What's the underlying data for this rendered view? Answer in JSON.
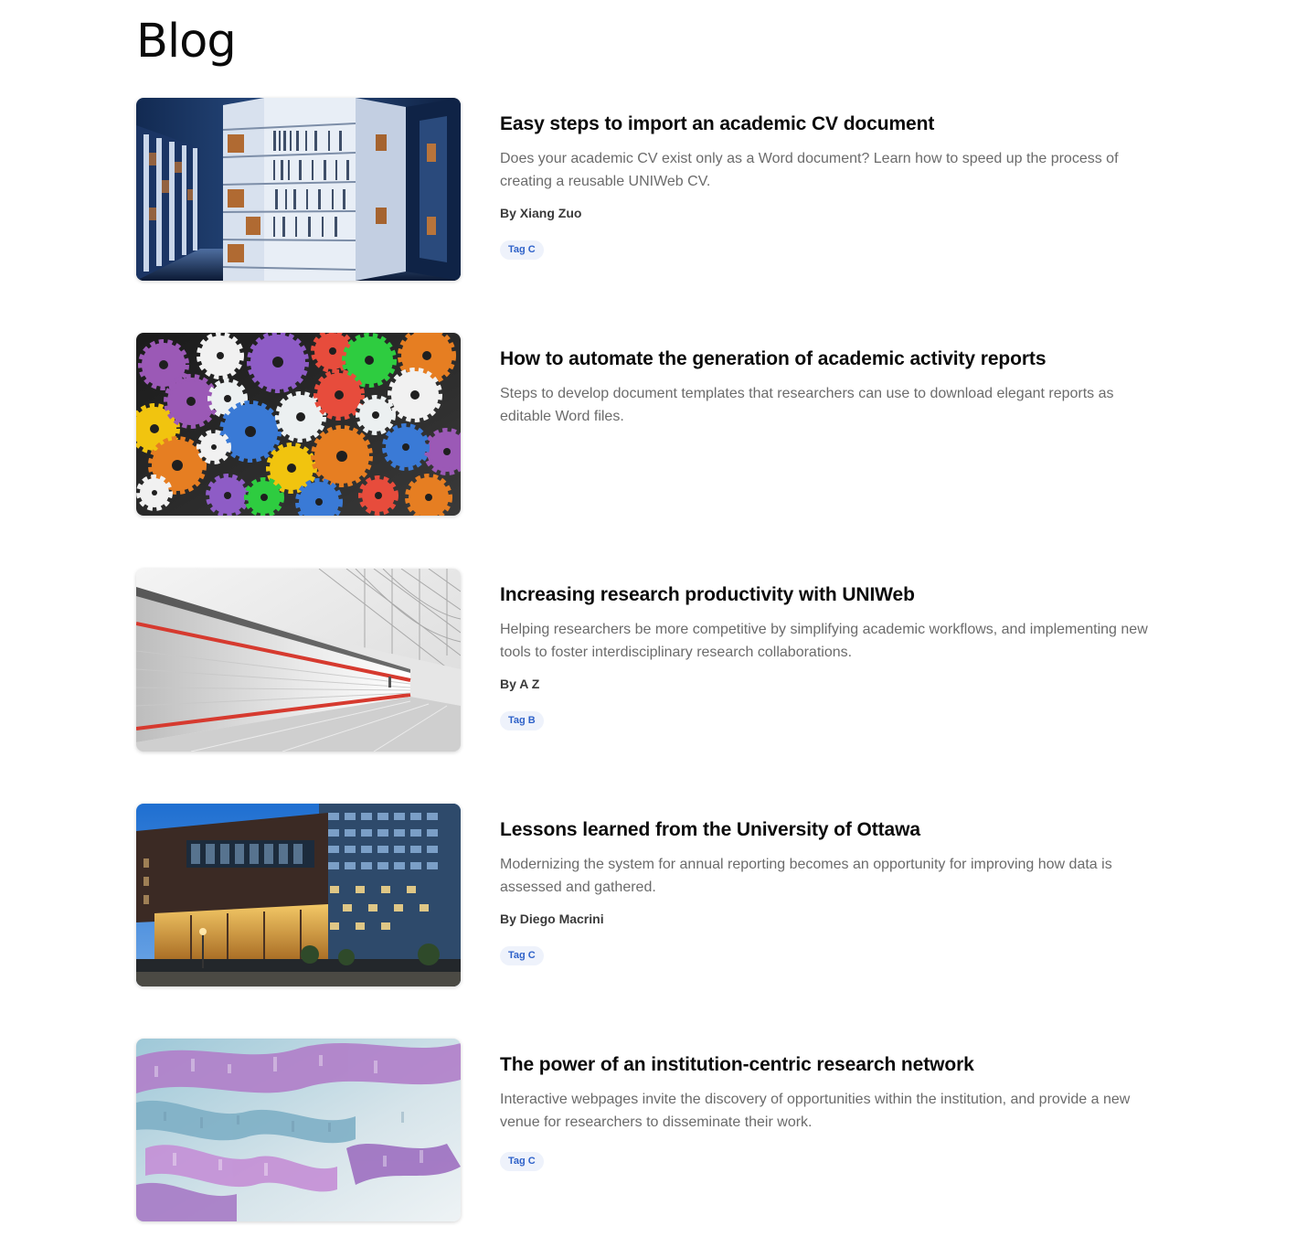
{
  "page": {
    "title": "Blog"
  },
  "posts": [
    {
      "title": "Easy steps to import an academic CV document",
      "excerpt": "Does your academic CV exist only as a Word document? Learn how to speed up the process of creating a reusable UNIWeb CV.",
      "author": "By Xiang Zuo",
      "tag": "Tag C",
      "image": "library-bookshelves-image"
    },
    {
      "title": "How to automate the generation of academic activity reports",
      "excerpt": "Steps to develop document templates that researchers can use to download elegant reports as editable Word files.",
      "image": "colorful-gears-image"
    },
    {
      "title": "Increasing research productivity with UNIWeb",
      "excerpt": "Helping researchers be more competitive by simplifying academic workflows, and implementing new tools to foster interdisciplinary research collaborations.",
      "author": "By A Z",
      "tag": "Tag B",
      "image": "train-station-motion-image"
    },
    {
      "title": "Lessons learned from the University of Ottawa",
      "excerpt": "Modernizing the system for annual reporting becomes an opportunity for improving how data is assessed and gathered.",
      "author": "By Diego Macrini",
      "tag": "Tag C",
      "image": "university-building-image"
    },
    {
      "title": "The power of an institution-centric research network",
      "excerpt": "Interactive webpages invite the discovery of opportunities within the institution, and provide a new venue for researchers to disseminate their work.",
      "tag": "Tag C",
      "image": "abstract-data-landscape-image"
    }
  ]
}
